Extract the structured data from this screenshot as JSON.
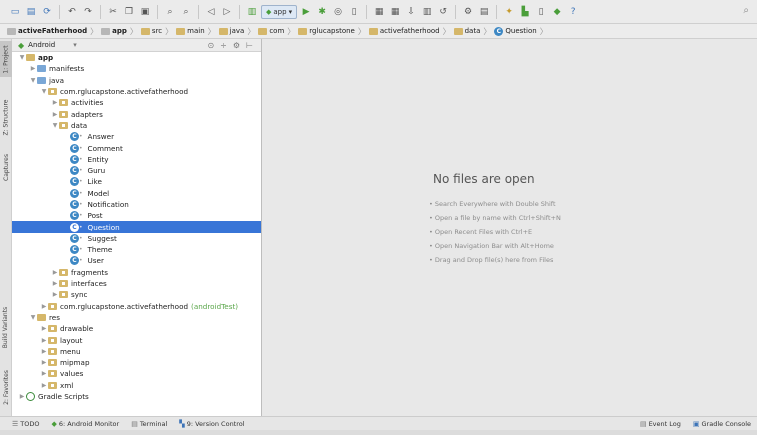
{
  "toolbar": {
    "run_config": "app",
    "help_glyph": "?"
  },
  "breadcrumbs": [
    {
      "label": "activeFatherhood",
      "kind": "project"
    },
    {
      "label": "app",
      "kind": "module"
    },
    {
      "label": "src",
      "kind": "folder"
    },
    {
      "label": "main",
      "kind": "folder"
    },
    {
      "label": "java",
      "kind": "folder"
    },
    {
      "label": "com",
      "kind": "folder"
    },
    {
      "label": "rglucapstone",
      "kind": "folder"
    },
    {
      "label": "activefatherhood",
      "kind": "folder"
    },
    {
      "label": "data",
      "kind": "folder"
    },
    {
      "label": "Question",
      "kind": "class"
    }
  ],
  "side_tabs": {
    "project": "1: Project",
    "structure": "Z: Structure",
    "captures": "Captures",
    "build_variants": "Build Variants",
    "favorites": "2: Favorites"
  },
  "panel": {
    "view_selector": "Android"
  },
  "tree": [
    {
      "label": "app",
      "indent": 0,
      "arrow": "▼",
      "icon": "module",
      "bold": true
    },
    {
      "label": "manifests",
      "indent": 1,
      "arrow": "▶",
      "icon": "dir"
    },
    {
      "label": "java",
      "indent": 1,
      "arrow": "▼",
      "icon": "dir"
    },
    {
      "label": "com.rglucapstone.activefatherhood",
      "indent": 2,
      "arrow": "▼",
      "icon": "pkg"
    },
    {
      "label": "activities",
      "indent": 3,
      "arrow": "▶",
      "icon": "pkg"
    },
    {
      "label": "adapters",
      "indent": 3,
      "arrow": "▶",
      "icon": "pkg"
    },
    {
      "label": "data",
      "indent": 3,
      "arrow": "▼",
      "icon": "pkg"
    },
    {
      "label": "Answer",
      "indent": 4,
      "arrow": "",
      "icon": "class"
    },
    {
      "label": "Comment",
      "indent": 4,
      "arrow": "",
      "icon": "class"
    },
    {
      "label": "Entity",
      "indent": 4,
      "arrow": "",
      "icon": "class"
    },
    {
      "label": "Guru",
      "indent": 4,
      "arrow": "",
      "icon": "class"
    },
    {
      "label": "Like",
      "indent": 4,
      "arrow": "",
      "icon": "class"
    },
    {
      "label": "Model",
      "indent": 4,
      "arrow": "",
      "icon": "class"
    },
    {
      "label": "Notification",
      "indent": 4,
      "arrow": "",
      "icon": "class"
    },
    {
      "label": "Post",
      "indent": 4,
      "arrow": "",
      "icon": "class"
    },
    {
      "label": "Question",
      "indent": 4,
      "arrow": "",
      "icon": "class",
      "selected": true
    },
    {
      "label": "Suggest",
      "indent": 4,
      "arrow": "",
      "icon": "class"
    },
    {
      "label": "Theme",
      "indent": 4,
      "arrow": "",
      "icon": "class"
    },
    {
      "label": "User",
      "indent": 4,
      "arrow": "",
      "icon": "class"
    },
    {
      "label": "fragments",
      "indent": 3,
      "arrow": "▶",
      "icon": "pkg"
    },
    {
      "label": "interfaces",
      "indent": 3,
      "arrow": "▶",
      "icon": "pkg"
    },
    {
      "label": "sync",
      "indent": 3,
      "arrow": "▶",
      "icon": "pkg"
    },
    {
      "label": "com.rglucapstone.activefatherhood",
      "suffix": "(androidTest)",
      "indent": 2,
      "arrow": "▶",
      "icon": "pkg"
    },
    {
      "label": "res",
      "indent": 1,
      "arrow": "▼",
      "icon": "res"
    },
    {
      "label": "drawable",
      "indent": 2,
      "arrow": "▶",
      "icon": "pkg"
    },
    {
      "label": "layout",
      "indent": 2,
      "arrow": "▶",
      "icon": "pkg"
    },
    {
      "label": "menu",
      "indent": 2,
      "arrow": "▶",
      "icon": "pkg"
    },
    {
      "label": "mipmap",
      "indent": 2,
      "arrow": "▶",
      "icon": "pkg"
    },
    {
      "label": "values",
      "indent": 2,
      "arrow": "▶",
      "icon": "pkg"
    },
    {
      "label": "xml",
      "indent": 2,
      "arrow": "▶",
      "icon": "pkg"
    },
    {
      "label": "Gradle Scripts",
      "indent": 0,
      "arrow": "▶",
      "icon": "gradle"
    }
  ],
  "editor": {
    "title": "No files are open",
    "hints": [
      "• Search Everywhere with Double Shift",
      "• Open a file by name with Ctrl+Shift+N",
      "• Open Recent Files with Ctrl+E",
      "• Open Navigation Bar with Alt+Home",
      "• Drag and Drop file(s) here from Files"
    ]
  },
  "bottom_tabs": {
    "todo": "TODO",
    "android_monitor": "6: Android Monitor",
    "terminal": "Terminal",
    "version_control": "9: Version Control",
    "event_log": "Event Log",
    "gradle_console": "Gradle Console"
  },
  "colors": {
    "selection": "#3875d7",
    "android_green": "#4a9e3a"
  }
}
